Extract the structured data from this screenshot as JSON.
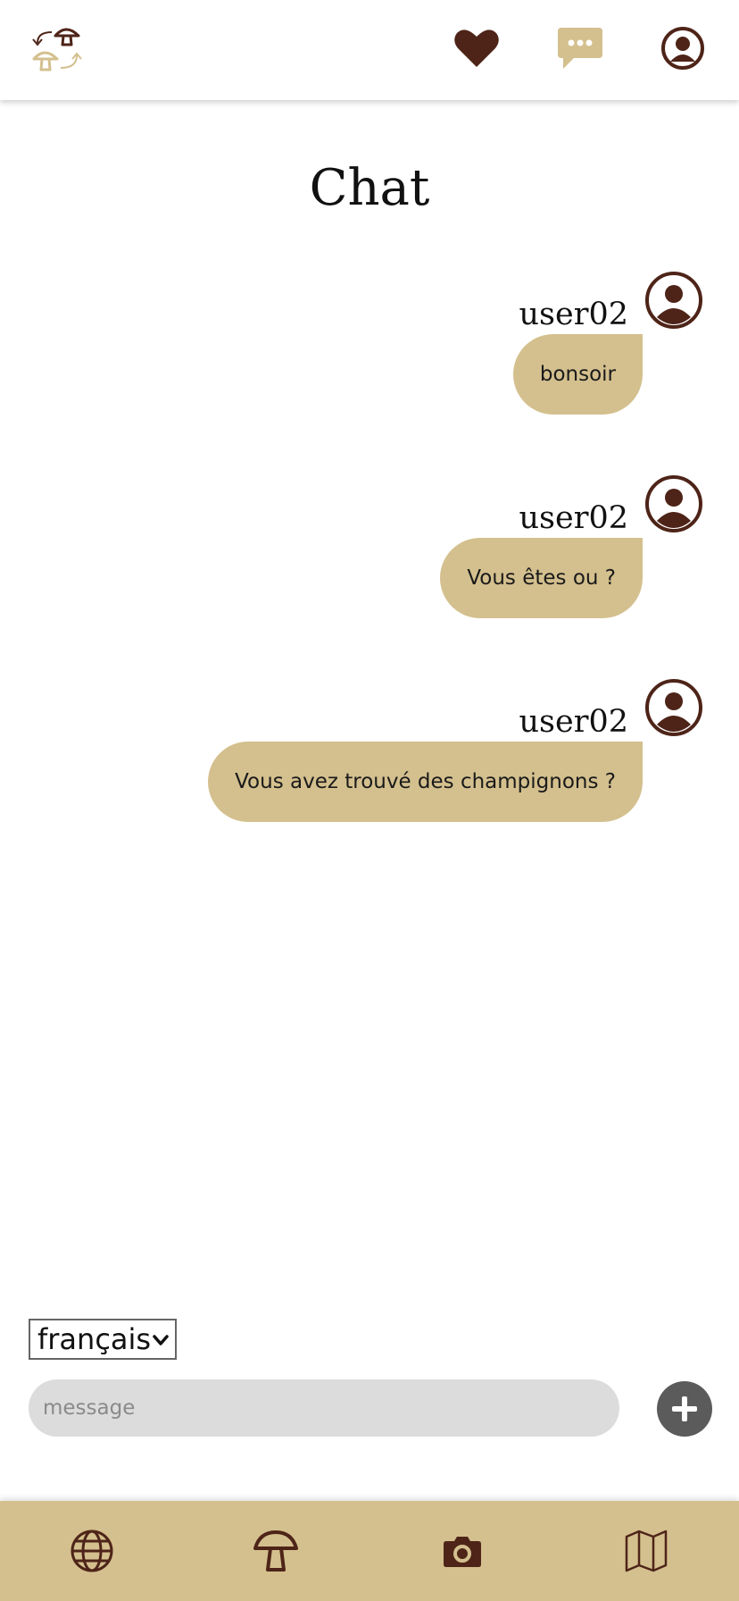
{
  "header": {
    "logo_icon": "mushroom-swap-logo",
    "favorites_icon": "heart-icon",
    "chat_icon": "chat-bubble-icon",
    "profile_icon": "user-circle-icon"
  },
  "page": {
    "title": "Chat"
  },
  "messages": [
    {
      "user": "user02",
      "text": "bonsoir"
    },
    {
      "user": "user02",
      "text": "Vous êtes ou ?"
    },
    {
      "user": "user02",
      "text": "Vous avez trouvé des champignons ?"
    }
  ],
  "composer": {
    "language": "français",
    "placeholder": "message",
    "send_icon": "plus-icon"
  },
  "bottom_nav": [
    {
      "icon": "globe-icon"
    },
    {
      "icon": "mushroom-icon"
    },
    {
      "icon": "camera-icon"
    },
    {
      "icon": "map-icon"
    }
  ],
  "colors": {
    "accent": "#d4c08e",
    "brown": "#4e2418",
    "button_gray": "#5b5b5b",
    "input_bg": "#dcdcdc"
  }
}
